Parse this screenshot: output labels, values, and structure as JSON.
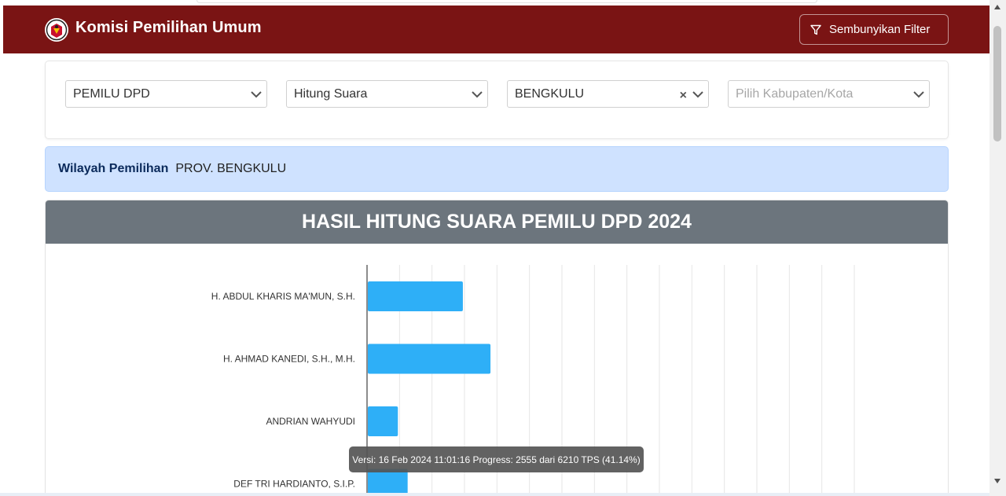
{
  "navbar": {
    "brand": "Komisi Pemilihan Umum",
    "filter_button": "Sembunyikan Filter",
    "background": "#7a1414"
  },
  "filters": {
    "election_type": "PEMILU DPD",
    "count_type": "Hitung Suara",
    "province": "BENGKULU",
    "regency_placeholder": "Pilih Kabupaten/Kota"
  },
  "region": {
    "label": "Wilayah Pemilihan",
    "value": "PROV. BENGKULU"
  },
  "chart_data": {
    "type": "bar",
    "orientation": "horizontal",
    "title": "HASIL HITUNG SUARA PEMILU DPD 2024",
    "categories": [
      "H. ABDUL KHARIS MA'MUN, S.H.",
      "H. AHMAD KANEDI, S.H., M.H.",
      "ANDRIAN WAHYUDI",
      "DEF TRI HARDIANTO, S.I.P."
    ],
    "values": [
      2.95,
      3.8,
      0.95,
      1.25
    ],
    "xlim": [
      0,
      15
    ],
    "grid": true,
    "bar_color": "#2eaff7"
  },
  "tooltip": {
    "text": "Versi: 16 Feb 2024 11:01:16 Progress: 2555 dari 6210 TPS (41.14%)"
  }
}
